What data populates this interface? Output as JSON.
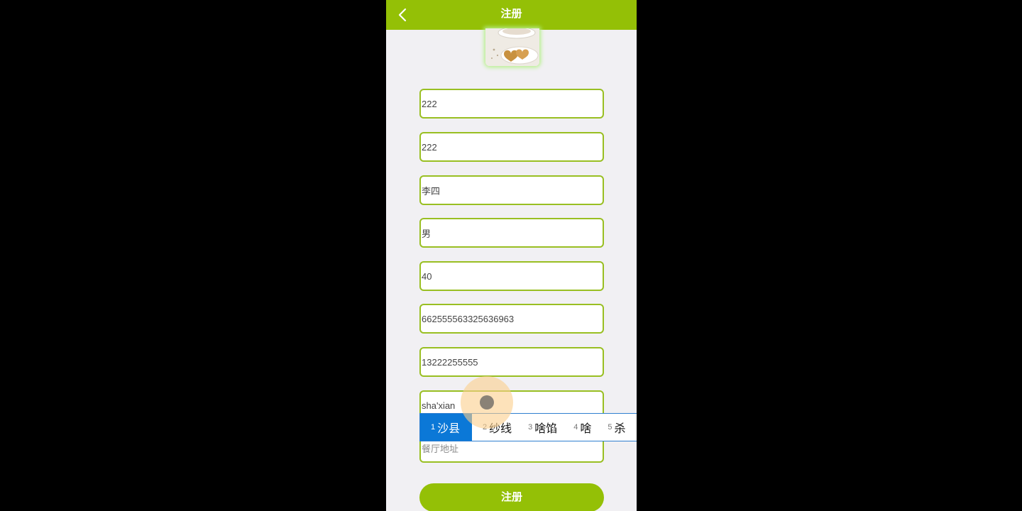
{
  "header": {
    "title": "注册",
    "back_icon": "chevron-left-icon"
  },
  "colors": {
    "brand_green": "#94c006",
    "field_border": "#99bf22",
    "ime_selected": "#0b78d7",
    "background": "#f1f0f3"
  },
  "form": {
    "fields": [
      {
        "value": "222"
      },
      {
        "value": "222"
      },
      {
        "value": "李四"
      },
      {
        "value": "男"
      },
      {
        "value": "40"
      },
      {
        "value": "662555563325636963"
      },
      {
        "value": "13222255555"
      },
      {
        "value": "sha'xian"
      },
      {
        "value": "",
        "placeholder": "餐厅地址"
      }
    ],
    "submit_label": "注册"
  },
  "ime": {
    "candidates": [
      {
        "num": "1",
        "text": "沙县"
      },
      {
        "num": "2",
        "text": "纱线"
      },
      {
        "num": "3",
        "text": "啥馅"
      },
      {
        "num": "4",
        "text": "啥"
      },
      {
        "num": "5",
        "text": "杀"
      }
    ]
  }
}
